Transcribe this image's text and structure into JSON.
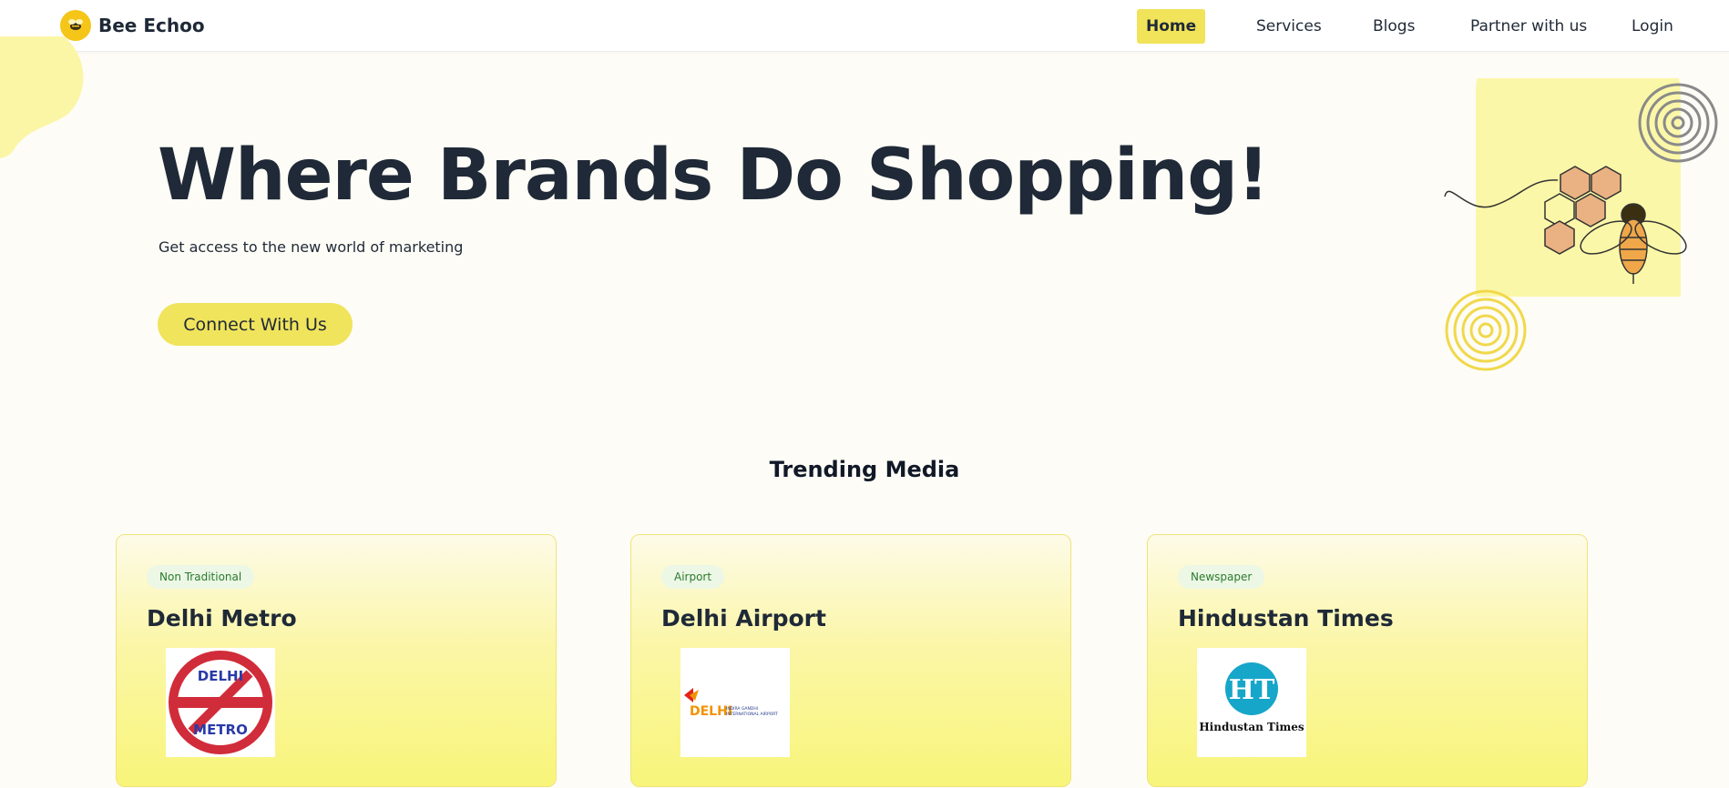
{
  "nav": {
    "brand_name": "Bee Echoo",
    "items": [
      {
        "label": "Home",
        "active": true
      },
      {
        "label": "Services",
        "active": false
      },
      {
        "label": "Blogs",
        "active": false
      },
      {
        "label": "Partner with us",
        "active": false
      },
      {
        "label": "Login",
        "active": false
      }
    ]
  },
  "hero": {
    "title": "Where Brands Do Shopping!",
    "subtitle": "Get access to the new world of marketing",
    "cta_label": "Connect With Us"
  },
  "trending": {
    "title": "Trending Media",
    "cards": [
      {
        "badge": "Non Traditional",
        "title": "Delhi Metro",
        "logo": "delhi-metro-logo",
        "logo_text_top": "DELHI",
        "logo_text_bottom": "METRO"
      },
      {
        "badge": "Airport",
        "title": "Delhi Airport",
        "logo": "delhi-airport-logo",
        "logo_text": "DELHI",
        "logo_subtext_1": "INDIRA GANDHI",
        "logo_subtext_2": "INTERNATIONAL AIRPORT"
      },
      {
        "badge": "Newspaper",
        "title": "Hindustan Times",
        "logo": "hindustan-times-logo",
        "logo_text": "HT",
        "logo_subtext": "Hindustan Times"
      }
    ]
  },
  "colors": {
    "accent": "#f0e45c",
    "page_bg": "#fdfcf6",
    "text": "#1f2937",
    "badge_text": "#2b7a2b"
  }
}
